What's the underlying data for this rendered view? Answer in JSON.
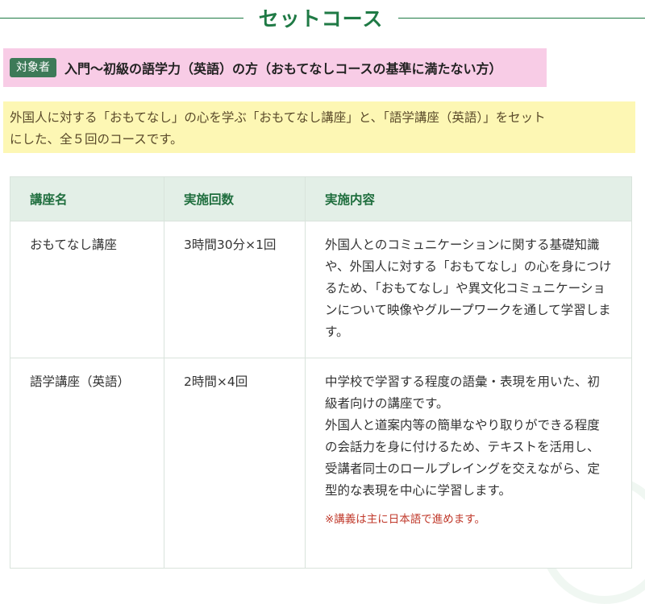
{
  "section": {
    "title": "セットコース"
  },
  "target": {
    "badge": "対象者",
    "text": "入門～初級の語学力（英語）の方（おもてなしコースの基準に満たない方）"
  },
  "description": {
    "line1": "外国人に対する「おもてなし」の心を学ぶ「おもてなし講座」と、「語学講座（英語）」をセット",
    "line2": "にした、全５回のコースです。"
  },
  "table": {
    "headers": [
      "講座名",
      "実施回数",
      "実施内容"
    ],
    "rows": [
      {
        "name": "おもてなし講座",
        "count": "3時間30分×1回",
        "content": "外国人とのコミュニケーションに関する基礎知識や、外国人に対する「おもてなし」の心を身につけるため、「おもてなし」や異文化コミュニケーションについて映像やグループワークを通して学習します。"
      },
      {
        "name": "語学講座（英語）",
        "count": "2時間×4回",
        "content_line1": "中学校で学習する程度の語彙・表現を用いた、初級者向けの講座です。",
        "content_line2": "外国人と道案内等の簡単なやり取りができる程度の会話力を身に付けるため、テキストを活用し、受講者同士のロールプレイングを交えながら、定型的な表現を中心に学習します。",
        "note": "※講義は主に日本語で進めます。"
      }
    ]
  },
  "colors": {
    "accent_green": "#1f7a45",
    "badge_green": "#3d7a58",
    "target_bg": "#f8cce6",
    "desc_bg": "#fdf7b4",
    "header_bg": "#e3efe7",
    "note_red": "#c0392b"
  }
}
